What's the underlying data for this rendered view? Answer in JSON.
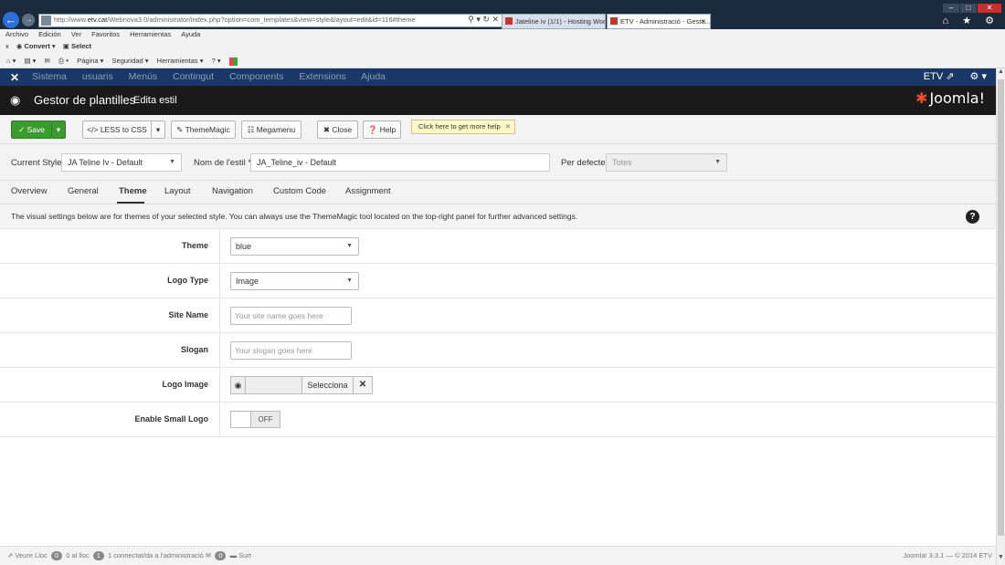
{
  "browser": {
    "url_prefix": "http://www.",
    "url_host": "etv.cat",
    "url_path": "/Webnova3.0/administrator/index.php?option=com_templates&view=style&layout=edit&id=116#theme",
    "addr_icons": "⚲ ▾ ↻ ✕",
    "tabs": [
      {
        "label": "Jateline iv (1/1) - Hosting Wor..."
      },
      {
        "label": "ETV - Administració - Gesto..."
      }
    ],
    "menubar": [
      "Archivo",
      "Edición",
      "Ver",
      "Favoritos",
      "Herramientas",
      "Ayuda"
    ],
    "convert": {
      "close": "x",
      "convert": "Convert",
      "select": "Select"
    },
    "cmdbar": [
      "Página ▾",
      "Seguridad ▾",
      "Herramientas ▾"
    ],
    "right_icons": "⌂ ★ ⚙"
  },
  "admin_nav": {
    "items": [
      "Sistema",
      "usuaris",
      "Menús",
      "Contingut",
      "Components",
      "Extensions",
      "Ajuda"
    ],
    "user": "ETV"
  },
  "title_bar": {
    "title": "Gestor de plantilles",
    "subtitle": "Edita estil",
    "brand": "Joomla!"
  },
  "toolbar": {
    "save": "Save",
    "less": "LESS to CSS",
    "theme_magic": "ThemeMagic",
    "megamenu": "Megamenu",
    "close": "Close",
    "help": "Help",
    "help_tip": "Click here to get more help"
  },
  "style_header": {
    "current_style_label": "Current Style",
    "current_style_value": "JA Teline Iv - Default",
    "name_label": "Nom de l'estil *",
    "name_value": "JA_Teline_iv - Default",
    "default_label": "Per defecte",
    "default_value": "Totes"
  },
  "tabs": [
    "Overview",
    "General",
    "Theme",
    "Layout",
    "Navigation",
    "Custom Code",
    "Assignment"
  ],
  "intro": "The visual settings below are for themes of your selected style. You can always use the ThemeMagic tool located on the top-right panel for further advanced settings.",
  "form": {
    "theme": {
      "label": "Theme",
      "value": "blue"
    },
    "logo_type": {
      "label": "Logo Type",
      "value": "Image"
    },
    "site_name": {
      "label": "Site Name",
      "placeholder": "Your site name goes here"
    },
    "slogan": {
      "label": "Slogan",
      "placeholder": "Your slogan goes here"
    },
    "logo_image": {
      "label": "Logo Image",
      "select": "Selecciona"
    },
    "small_logo": {
      "label": "Enable Small Logo",
      "state": "OFF"
    }
  },
  "status": {
    "view_site": "Veure Lloc",
    "visitors_count": "0",
    "visitors_label": "0 al lloc",
    "admins_count": "1",
    "admins_label": "1 connectat/da a l'administració",
    "messages_count": "0",
    "logout": "Surt",
    "version": "Joomla! 3.3.1 — © 2014 ETV"
  }
}
